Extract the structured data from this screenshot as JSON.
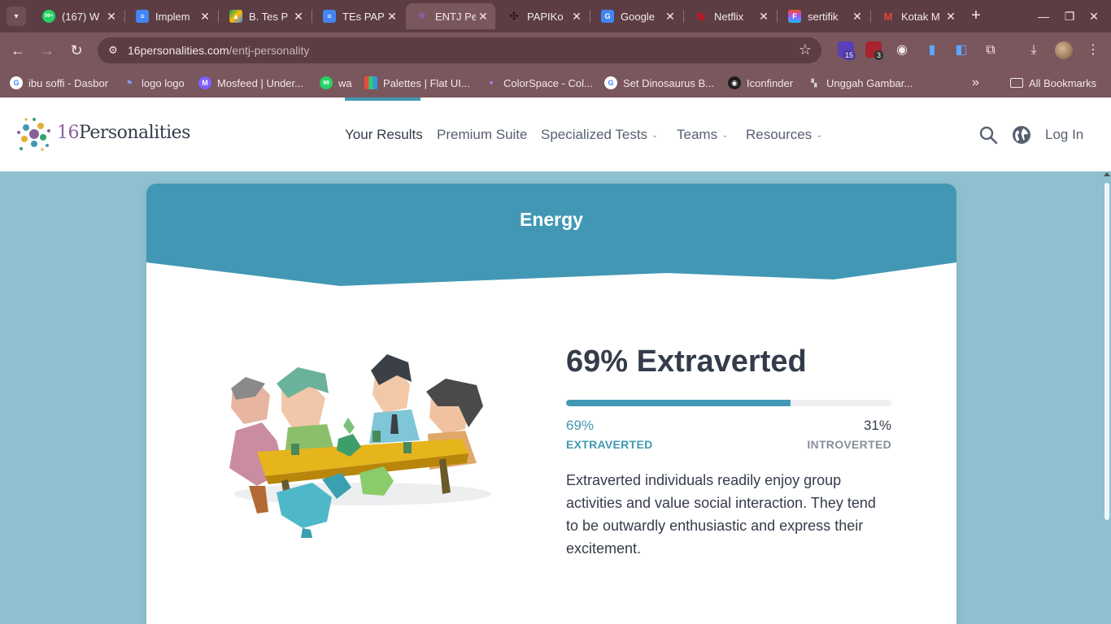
{
  "browser": {
    "tabs": [
      {
        "title": "(167) W",
        "favicon": "whatsapp-icon",
        "color": "#25d366",
        "glyph": "99+"
      },
      {
        "title": "Implem",
        "favicon": "google-docs-icon",
        "color": "#4285f4",
        "glyph": "≡"
      },
      {
        "title": "B. Tes P",
        "favicon": "google-drive-icon",
        "color": "#fbbc04",
        "glyph": "▲"
      },
      {
        "title": "TEs PAP",
        "favicon": "google-docs-icon",
        "color": "#4285f4",
        "glyph": "≡"
      },
      {
        "title": "ENTJ Pe",
        "favicon": "16personalities-icon",
        "color": "#88619a",
        "glyph": "✺",
        "active": true
      },
      {
        "title": "PAPIKo",
        "favicon": "papikostick-icon",
        "color": "#3a2a2e",
        "glyph": "✣"
      },
      {
        "title": "Google",
        "favicon": "google-translate-icon",
        "color": "#4285f4",
        "glyph": "G"
      },
      {
        "title": "Netflix",
        "favicon": "netflix-icon",
        "color": "#e50914",
        "glyph": "N"
      },
      {
        "title": "sertifik",
        "favicon": "figma-icon",
        "color": "#f24e1e",
        "glyph": "F"
      },
      {
        "title": "Kotak M",
        "favicon": "gmail-icon",
        "color": "#ea4335",
        "glyph": "M"
      }
    ],
    "url_domain": "16personalities.com",
    "url_path": "/entj-personality",
    "extension_badges": {
      "first": "15",
      "second": "3"
    },
    "bookmarks": [
      {
        "label": "ibu soffi - Dasbor",
        "icon": "google-icon",
        "color": "#4285f4",
        "glyph": "G"
      },
      {
        "label": "logo logo",
        "icon": "flag-icon",
        "color": "#4a6fd8",
        "glyph": "⚑"
      },
      {
        "label": "Mosfeed | Under...",
        "icon": "mosfeed-icon",
        "color": "#7b61ff",
        "glyph": "M"
      },
      {
        "label": "wa",
        "icon": "whatsapp-icon",
        "color": "#25d366",
        "glyph": "99"
      },
      {
        "label": "Palettes | Flat UI...",
        "icon": "palette-icon",
        "color": "#e67e22",
        "glyph": "▦"
      },
      {
        "label": "ColorSpace - Col...",
        "icon": "colorspace-icon",
        "color": "#8e6cf0",
        "glyph": "✦"
      },
      {
        "label": "Set Dinosaurus B...",
        "icon": "google-icon",
        "color": "#4285f4",
        "glyph": "G"
      },
      {
        "label": "Iconfinder",
        "icon": "iconfinder-icon",
        "color": "#222222",
        "glyph": "◉"
      },
      {
        "label": "Unggah Gambar...",
        "icon": "upload-image-icon",
        "color": "#9a9a9a",
        "glyph": "▚"
      }
    ],
    "all_bookmarks": "All Bookmarks"
  },
  "site": {
    "logo_num": "16",
    "logo_word": "Personalities",
    "nav": [
      {
        "label": "Your Results",
        "dropdown": false
      },
      {
        "label": "Premium Suite",
        "dropdown": false
      },
      {
        "label": "Specialized Tests",
        "dropdown": true
      },
      {
        "label": "Teams",
        "dropdown": true
      },
      {
        "label": "Resources",
        "dropdown": true
      }
    ],
    "login": "Log In"
  },
  "card": {
    "title": "Energy",
    "result_title": "69% Extraverted",
    "progress": 0.69,
    "left_pct": "69%",
    "left_label": "EXTRAVERTED",
    "right_pct": "31%",
    "right_label": "INTROVERTED",
    "description": "Extraverted individuals readily enjoy group activities and value social interaction. They tend to be outwardly enthusiastic and express their excitement."
  },
  "colors": {
    "accent": "#4298b4",
    "header_band": "#4298b4",
    "page_bg": "#8ec0d0",
    "browser_frame": "#7a565d"
  }
}
